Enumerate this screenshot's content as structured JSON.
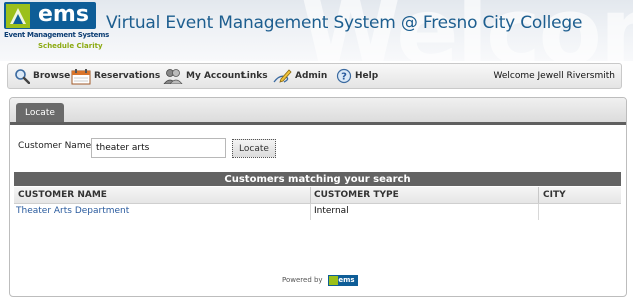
{
  "brand": {
    "logo_text": "ems",
    "logo_subtitle": "Event Management Systems",
    "logo_tagline": "Schedule Clarity",
    "watermark": "Welcome",
    "colors": {
      "primary": "#0e5d97",
      "accent": "#9bc01a",
      "title": "#1d5e8f"
    }
  },
  "header": {
    "title": "Virtual Event Management System @ Fresno City College"
  },
  "nav": {
    "items": [
      {
        "label": "Browse",
        "icon": "magnifier-icon"
      },
      {
        "label": "Reservations",
        "icon": "calendar-icon"
      },
      {
        "label": "My Account",
        "icon": "users-icon"
      },
      {
        "label": "Links",
        "icon": ""
      },
      {
        "label": "Admin",
        "icon": "pencil-icon"
      },
      {
        "label": "Help",
        "icon": "help-icon"
      }
    ],
    "welcome": "Welcome Jewell Riversmith"
  },
  "tabs": [
    {
      "label": "Locate",
      "active": true
    }
  ],
  "search": {
    "label": "Customer Name:",
    "value": "theater arts",
    "button_label": "Locate"
  },
  "results": {
    "caption": "Customers matching your search",
    "columns": [
      "CUSTOMER NAME",
      "CUSTOMER TYPE",
      "CITY"
    ],
    "rows": [
      {
        "name": "Theater Arts Department",
        "type": "Internal",
        "city": ""
      }
    ]
  },
  "footer": {
    "powered_by": "Powered by",
    "logo_text": "ems"
  }
}
